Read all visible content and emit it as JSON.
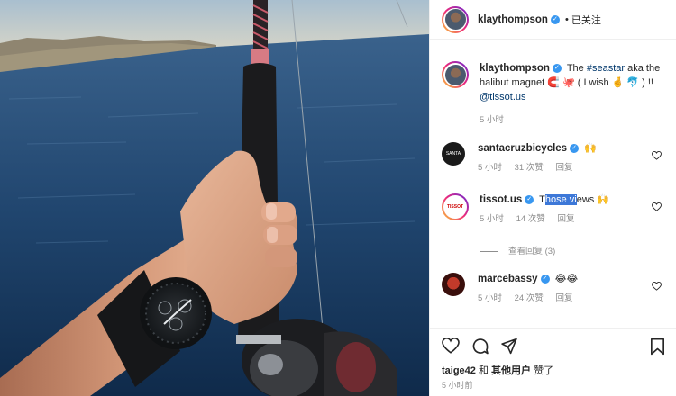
{
  "post": {
    "author": "klaythompson",
    "follow_status": "已关注",
    "separator": "•"
  },
  "caption": {
    "author": "klaythompson",
    "text_before": "The",
    "hashtag": "#seastar",
    "text_after": "aka the halibut magnet 🧲 🐙 ( I wish 🤞 🐬 ) !!",
    "mention": "@tissot.us",
    "time": "5 小时"
  },
  "comments": [
    {
      "author": "santacruzbicycles",
      "text": "🙌",
      "time": "5 小时",
      "likes": "31 次赞",
      "reply": "回复"
    },
    {
      "author": "tissot.us",
      "text_first": "T",
      "text_selected": "hose vi",
      "text_last": "ews 🙌",
      "time": "5 小时",
      "likes": "14 次赞",
      "reply": "回复",
      "view_replies": "查看回复 (3)"
    },
    {
      "author": "marcebassy",
      "text": "😂😂",
      "time": "5 小时",
      "likes": "24 次赞",
      "reply": "回复"
    }
  ],
  "footer": {
    "liked_by_user": "taige42",
    "liked_joiner": "和",
    "liked_others": "其他用户",
    "liked_suffix": "赞了",
    "time_ago": "5 小时前"
  },
  "colors": {
    "verified": "#3897f0",
    "link": "#00376b",
    "selection": "#3d78d8",
    "muted": "#8e8e8e"
  },
  "icons": [
    "heart-icon",
    "comment-icon",
    "share-icon",
    "bookmark-icon",
    "verified-icon",
    "small-heart-icon"
  ]
}
